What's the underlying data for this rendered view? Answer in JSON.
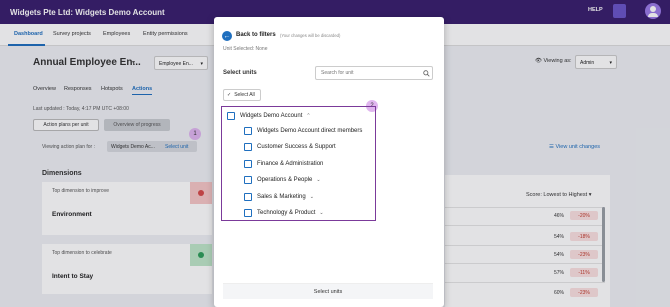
{
  "app": {
    "title": "Widgets Pte Ltd: Widgets Demo Account",
    "help": "HELP"
  },
  "nav": {
    "tabs": [
      "Dashboard",
      "Survey projects",
      "Employees",
      "Entity permissions"
    ]
  },
  "survey": {
    "title": "Annual Employee En...",
    "select_value": "Employee En..."
  },
  "viewing_as": {
    "label": "Viewing as:",
    "value": "Admin"
  },
  "subtabs": [
    "Overview",
    "Responses",
    "Hotspots",
    "Actions"
  ],
  "last_updated": "Last updated : Today, 4:17 PM UTC +08:00",
  "plan_buttons": {
    "per_unit": "Action plans per unit",
    "overview": "Overview of progress"
  },
  "viewing_plan": {
    "label": "Viewing action plan for :",
    "unit": "Widgets Demo Ac...",
    "select_link": "Select unit"
  },
  "badges": {
    "one": "1",
    "two": "2"
  },
  "view_changes": "View unit changes",
  "dimensions": {
    "title": "Dimensions",
    "improve_label": "Top dimension to improve",
    "improve_name": "Environment",
    "celebrate_label": "Top dimension to celebrate",
    "celebrate_name": "Intent to Stay"
  },
  "score_sort": "Score: Lowest to Highest",
  "rows": [
    {
      "value": "46%",
      "delta": "-20%"
    },
    {
      "value": "54%",
      "delta": "-18%"
    },
    {
      "value": "54%",
      "delta": "-23%"
    },
    {
      "value": "57%",
      "delta": "-11%"
    },
    {
      "value": "60%",
      "delta": "-23%"
    }
  ],
  "modal": {
    "back_label": "Back to filters",
    "back_note": "(Your changes will be discarded)",
    "unit_selected": "Unit Selected: None",
    "select_units_label": "Select units",
    "search_placeholder": "Search for unit",
    "select_all": "Select All",
    "tree": [
      {
        "label": "Widgets Demo Account"
      },
      {
        "label": "Widgets Demo Account direct members"
      },
      {
        "label": "Customer Success & Support"
      },
      {
        "label": "Finance & Administration"
      },
      {
        "label": "Operations & People"
      },
      {
        "label": "Sales & Marketing"
      },
      {
        "label": "Technology & Product"
      }
    ],
    "footer_button": "Select units"
  },
  "colors": {
    "topbar": "#3a1f6e",
    "accent": "#1f6fbf",
    "highlight": "#7b3a9a",
    "badge": "#e0b6ef"
  }
}
